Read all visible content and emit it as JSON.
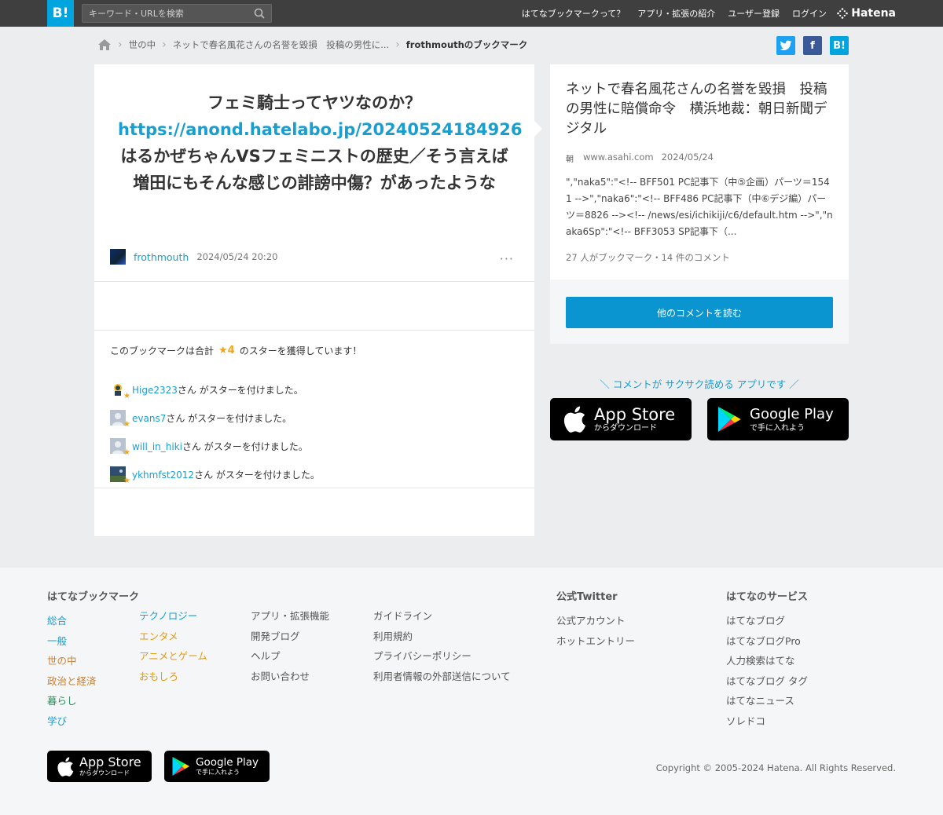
{
  "header": {
    "logo_label": "B!",
    "search_placeholder": "キーワード・URLを検索",
    "nav": [
      "はてなブックマークって？",
      "アプリ・拡張の紹介",
      "ユーザー登録",
      "ログイン"
    ],
    "hatena_label": "Hatena"
  },
  "breadcrumb": {
    "items": [
      "世の中",
      "ネットで春名風花さんの名誉を毀損　投稿の男性に...",
      "frothmouthのブックマーク"
    ]
  },
  "social": {
    "twitter": "t",
    "facebook": "f",
    "hatebu": "B!"
  },
  "bookmark": {
    "line1": "フェミ騎士ってヤツなのか？",
    "link": "https://anond.hatelabo.jp/20240524184926",
    "line2": "はるかぜちゃんVSフェミニストの歴史／そう言えば増田にもそんな感じの誹謗中傷？があったような",
    "user": "frothmouth",
    "date": "2024/05/24 20:20",
    "more": "···"
  },
  "stars": {
    "summary_pre": "このブックマークは合計",
    "count": "★4",
    "summary_post": "のスターを獲得しています！",
    "list": [
      {
        "name": "Hige2323",
        "text": "さん がスターを付けました。"
      },
      {
        "name": "evans7",
        "text": "さん がスターを付けました。"
      },
      {
        "name": "will_in_hiki",
        "text": "さん がスターを付けました。"
      },
      {
        "name": "ykhmfst2012",
        "text": "さん がスターを付けました。"
      }
    ]
  },
  "entry": {
    "title": "ネットで春名風花さんの名誉を毀損　投稿の男性に賠償命令　横浜地裁：朝日新聞デジタル",
    "domain": "www.asahi.com",
    "date": "2024/05/24",
    "excerpt": "\",\"naka5\":\"<!-- BFF501 PC記事下（中⑤企画）パーツ＝1541 -->\",\"naka6\":\"<!-- BFF486 PC記事下（中⑥デジ編）パーツ＝8826 --><!-- /news/esi/ichikiji/c6/default.htm -->\",\"naka6Sp\":\"<!-- BFF3053 SP記事下（...",
    "count": "27 人がブックマーク・14 件のコメント",
    "read_more": "他のコメントを読む"
  },
  "promo": {
    "text": "＼ コメントが サクサク読める アプリです ／",
    "appstore_big": "App Store",
    "appstore_small": "からダウンロード",
    "google_big": "Google Play",
    "google_small": "で手に入れよう"
  },
  "footer": {
    "col1_title": "はてなブックマーク",
    "cats_a": [
      "総合",
      "一般",
      "世の中",
      "政治と経済",
      "暮らし",
      "学び"
    ],
    "cats_b": [
      "テクノロジー",
      "エンタメ",
      "アニメとゲーム",
      "おもしろ"
    ],
    "links_c": [
      "アプリ・拡張機能",
      "開発ブログ",
      "ヘルプ",
      "お問い合わせ"
    ],
    "links_d": [
      "ガイドライン",
      "利用規約",
      "プライバシーポリシー",
      "利用者情報の外部送信について"
    ],
    "twitter_title": "公式Twitter",
    "twitter_links": [
      "公式アカウント",
      "ホットエントリー"
    ],
    "services_title": "はてなのサービス",
    "services": [
      "はてなブログ",
      "はてなブログPro",
      "人力検索はてな",
      "はてなブログ タグ",
      "はてなニュース",
      "ソレドコ"
    ],
    "copyright": "Copyright © 2005-2024 Hatena. All Rights Reserved."
  },
  "colors": {
    "accent": "#00a4de",
    "link": "#1a9ecf",
    "star": "#f2a41b",
    "topbar": "#3f3f3f"
  }
}
